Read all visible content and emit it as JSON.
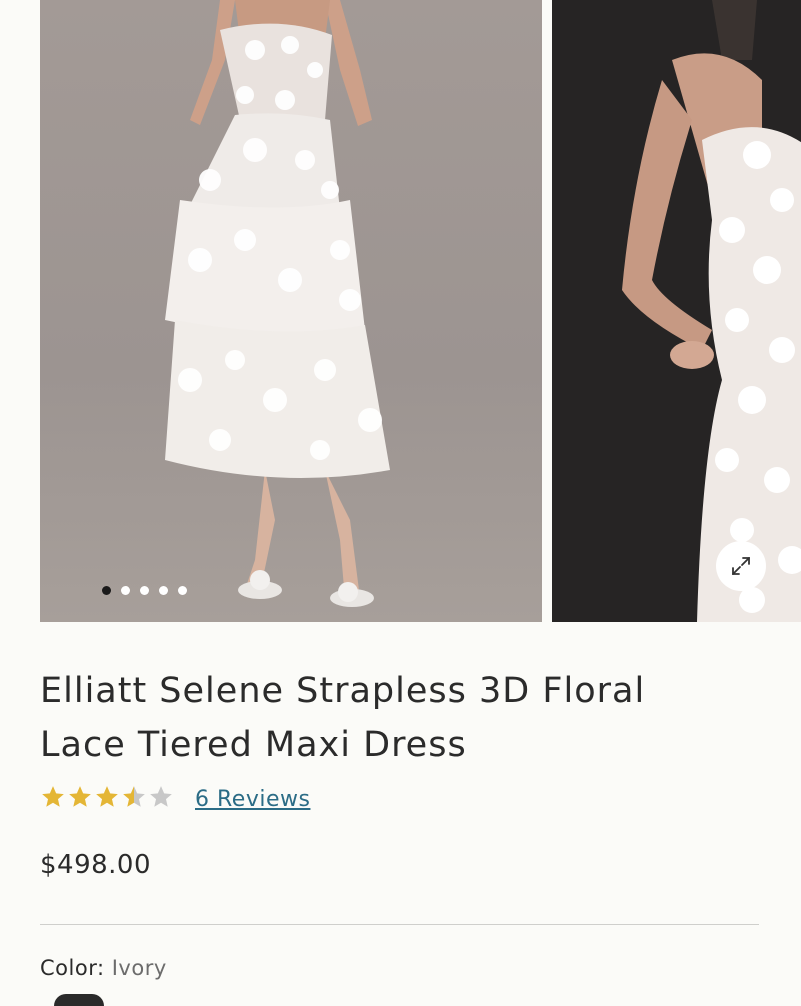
{
  "gallery": {
    "slide_count": 5,
    "active_index": 0
  },
  "product": {
    "title": "Elliatt Selene Strapless 3D Floral Lace Tiered Maxi Dress",
    "rating": 3.5,
    "rating_max": 5,
    "reviews_label": "6 Reviews",
    "price": "$498.00",
    "color_label": "Color:",
    "color_value": "Ivory"
  },
  "colors": {
    "star_filled": "#e4b636",
    "star_empty": "#c8c8c8",
    "link": "#2b6c86"
  },
  "icons": {
    "expand": "expand-arrows-icon",
    "star": "star-icon"
  }
}
